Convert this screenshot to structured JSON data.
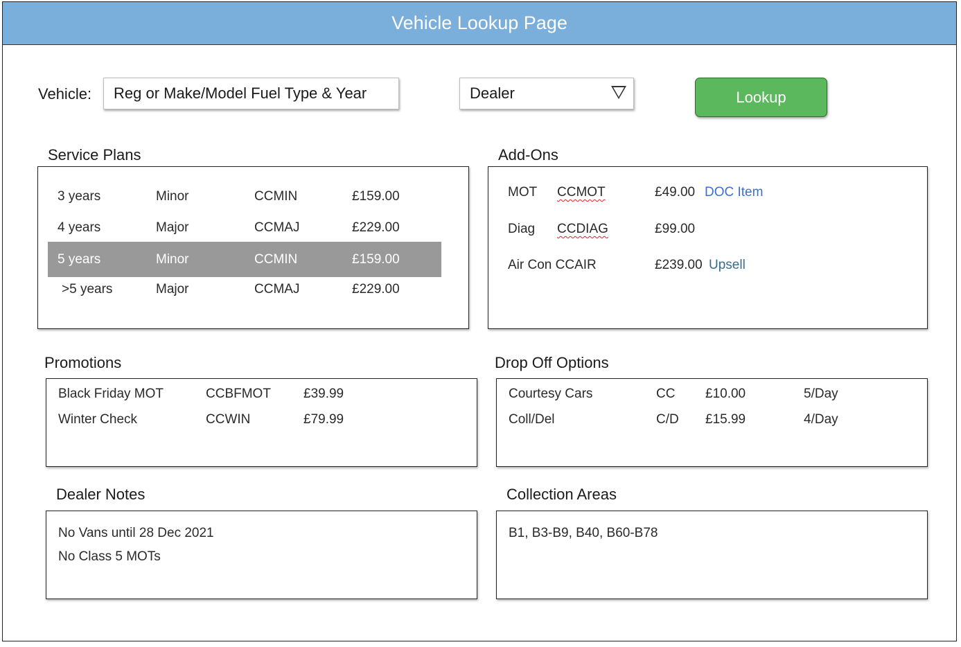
{
  "header": {
    "title": "Vehicle Lookup Page"
  },
  "search": {
    "vehicle_label": "Vehicle:",
    "vehicle_placeholder": "Reg or Make/Model Fuel Type & Year",
    "dealer_value": "Dealer",
    "lookup_label": "Lookup"
  },
  "service_plans": {
    "title": "Service Plans",
    "rows": [
      {
        "period": "3 years",
        "type": "Minor",
        "code": "CCMIN",
        "price": "£159.00"
      },
      {
        "period": "4 years",
        "type": "Major",
        "code": "CCMAJ",
        "price": "£229.00"
      },
      {
        "period": "5 years",
        "type": "Minor",
        "code": "CCMIN",
        "price": "£159.00"
      },
      {
        "period": ">5 years",
        "type": "Major",
        "code": "CCMAJ",
        "price": "£229.00"
      }
    ]
  },
  "addons": {
    "title": "Add-Ons",
    "rows": [
      {
        "name": "MOT",
        "code": "CCMOT",
        "price": "£49.00",
        "link": "DOC Item"
      },
      {
        "name": "Diag",
        "code": "CCDIAG",
        "price": "£99.00"
      },
      {
        "name": "Air Con CCAIR",
        "price": "£239.00",
        "link": "Upsell"
      }
    ]
  },
  "promotions": {
    "title": "Promotions",
    "rows": [
      {
        "name": "Black Friday MOT",
        "code": "CCBFMOT",
        "price": "£39.99"
      },
      {
        "name": "Winter Check",
        "code": "CCWIN",
        "price": "£79.99"
      }
    ]
  },
  "drop_off": {
    "title": "Drop Off Options",
    "rows": [
      {
        "name": "Courtesy Cars",
        "code": "CC",
        "price": "£10.00",
        "limit": "5/Day"
      },
      {
        "name": "Coll/Del",
        "code": "C/D",
        "price": "£15.99",
        "limit": "4/Day"
      }
    ]
  },
  "dealer_notes": {
    "title": "Dealer Notes",
    "lines": [
      "No Vans until 28 Dec 2021",
      "No Class 5 MOTs"
    ]
  },
  "collection_areas": {
    "title": "Collection Areas",
    "text": "B1, B3-B9, B40, B60-B78"
  },
  "colors": {
    "header": "#7aaedb",
    "lookup_button": "#5cb85c",
    "selected_row": "#999999",
    "link": "#3a6fd4"
  }
}
